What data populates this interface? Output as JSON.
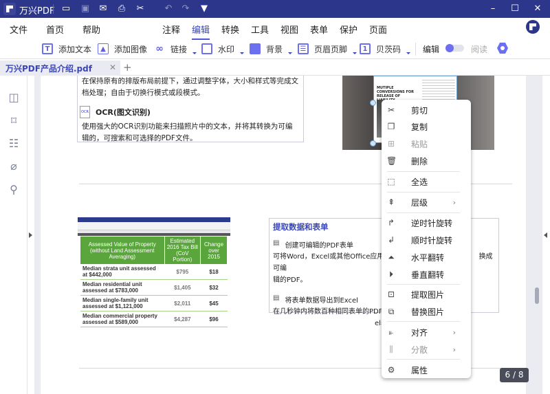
{
  "app": {
    "title": "万兴PDF"
  },
  "menu": [
    "文件",
    "首页",
    "帮助",
    "注释",
    "编辑",
    "转换",
    "工具",
    "视图",
    "表单",
    "保护",
    "页面"
  ],
  "toolbar": {
    "add_text": "添加文本",
    "add_image": "添加图像",
    "link": "链接",
    "watermark": "水印",
    "background": "背景",
    "header_footer": "页眉页脚",
    "bates": "贝茨码",
    "edit": "编辑",
    "read": "阅读"
  },
  "tab": {
    "name": "万兴PDF产品介绍.pdf",
    "add": "+"
  },
  "doc": {
    "para1": "在保持原有的排版布局前提下，通过调整字体，大小和样式等完成文档处理；自由于切换行模式或段模式。",
    "ocr_title": "OCR(图文识别)",
    "ocr_text": "使用强大的OCR识别功能来扫描照片中的文本，并将其转换为可编辑的，可搜索和可选择的PDF文件。",
    "extract_title": "提取数据和表单",
    "create_form": "创建可编辑的PDF表单",
    "create_form_text": "可将Word，Excel或其他Office应用程,",
    "create_form_text2": "换成可编",
    "create_form_text3": "辑的PDF。",
    "export": "将表单数据导出到Excel",
    "export_text": "在几秒钟内将数百种相同表单的PDF表",
    "export_text2": "el表单。",
    "photo_heading": "MUTIPLE CONVERSIONS FOR RELEASE OF LIABILITY DOCUMENTS",
    "table": {
      "headers": [
        "Assessed Value of Property (without Land Assessment Averaging)",
        "Estimated 2016 Tax Bill (CoV Portion)",
        "Change over 2015"
      ],
      "rows": [
        [
          "Median strata unit assessed at $442,000",
          "$795",
          "$18"
        ],
        [
          "Median residential unit assessed at $783,000",
          "$1,405",
          "$32"
        ],
        [
          "Median single-family unit assessed at $1,121,000",
          "$2,011",
          "$45"
        ],
        [
          "Median commercial property assessed at $589,000",
          "$4,287",
          "$96"
        ]
      ]
    }
  },
  "context_menu": [
    {
      "label": "剪切",
      "icon": "scissors-icon"
    },
    {
      "label": "复制",
      "icon": "copy-icon"
    },
    {
      "label": "粘贴",
      "icon": "paste-icon",
      "disabled": true
    },
    {
      "label": "删除",
      "icon": "trash-icon"
    },
    {
      "label": "全选",
      "icon": "select-all-icon"
    },
    {
      "label": "层级",
      "icon": "layer-icon",
      "submenu": true
    },
    {
      "label": "逆时针旋转",
      "icon": "rotate-ccw-icon"
    },
    {
      "label": "顺时针旋转",
      "icon": "rotate-cw-icon"
    },
    {
      "label": "水平翻转",
      "icon": "flip-horizontal-icon"
    },
    {
      "label": "垂直翻转",
      "icon": "flip-vertical-icon"
    },
    {
      "label": "提取图片",
      "icon": "extract-image-icon"
    },
    {
      "label": "替换图片",
      "icon": "replace-image-icon"
    },
    {
      "label": "对齐",
      "icon": "align-icon",
      "submenu": true
    },
    {
      "label": "分散",
      "icon": "distribute-icon",
      "submenu": true,
      "disabled": true
    },
    {
      "label": "属性",
      "icon": "gear-icon"
    }
  ],
  "page_counter": "6 / 8"
}
